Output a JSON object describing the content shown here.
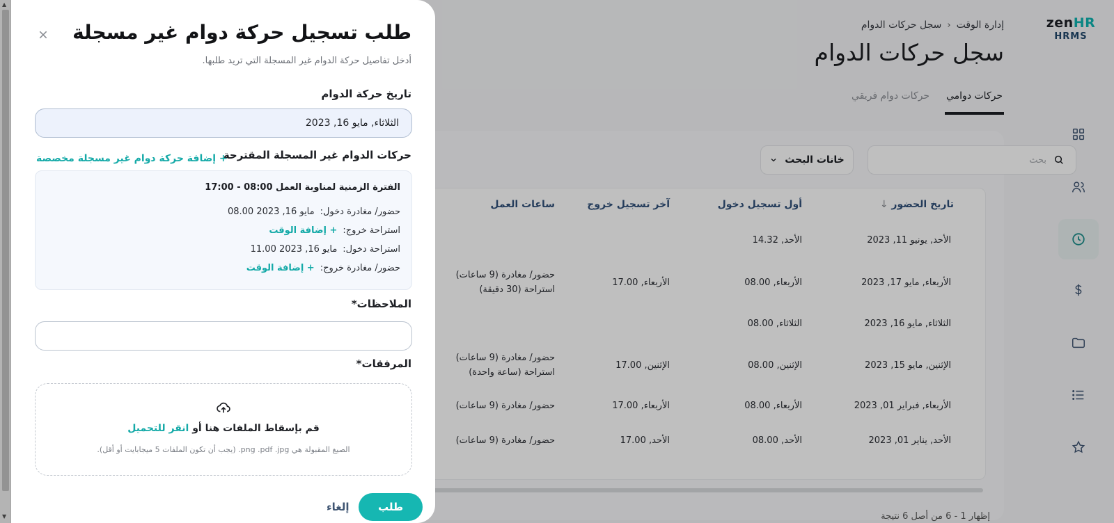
{
  "logo": {
    "zen": "zen",
    "hr": "HR",
    "sub": "HRMS"
  },
  "breadcrumb": {
    "parent": "إدارة الوقت",
    "current": "سجل حركات الدوام"
  },
  "page_title": "سجل حركات الدوام",
  "tabs": [
    {
      "label": "حركات دوامي",
      "active": true
    },
    {
      "label": "حركات دوام فريقي",
      "active": false
    }
  ],
  "search": {
    "placeholder": "بحث",
    "filter_label": "خانات البحث"
  },
  "table": {
    "headers": [
      "تاريخ الحضور",
      "أول تسجيل دخول",
      "آخر تسجيل خروج",
      "ساعات العمل"
    ],
    "rows": [
      {
        "date": "الأحد, يونيو 11, 2023",
        "first_in": "الأحد, 14.32",
        "last_out": "",
        "hours": [
          "",
          ""
        ]
      },
      {
        "date": "الأربعاء, مايو 17, 2023",
        "first_in": "الأربعاء, 08.00",
        "last_out": "الأربعاء, 17.00",
        "hours": [
          "حضور/ مغادرة (9 ساعات)",
          "استراحة (30 دقيقة)"
        ]
      },
      {
        "date": "الثلاثاء, مايو 16, 2023",
        "first_in": "الثلاثاء, 08.00",
        "last_out": "",
        "hours": [
          "",
          ""
        ]
      },
      {
        "date": "الإثنين, مايو 15, 2023",
        "first_in": "الإثنين, 08.00",
        "last_out": "الإثنين, 17.00",
        "hours": [
          "حضور/ مغادرة (9 ساعات)",
          "استراحة (ساعة واحدة)"
        ]
      },
      {
        "date": "الأربعاء, فبراير 01, 2023",
        "first_in": "الأربعاء, 08.00",
        "last_out": "الأربعاء, 17.00",
        "hours": [
          "حضور/ مغادرة (9 ساعات)",
          ""
        ]
      },
      {
        "date": "الأحد, يناير 01, 2023",
        "first_in": "الأحد, 08.00",
        "last_out": "الأحد, 17.00",
        "hours": [
          "حضور/ مغادرة (9 ساعات)",
          ""
        ]
      }
    ]
  },
  "pagination": {
    "text": "إظهار 1 - 6 من أصل 6 نتيجة"
  },
  "modal": {
    "title": "طلب تسجيل حركة دوام غير مسجلة",
    "subtitle": "أدخل تفاصيل حركة الدوام غير المسجلة التي تريد طلبها.",
    "date_label": "تاريخ حركة الدوام",
    "date_value": "الثلاثاء, مايو 16, 2023",
    "suggested_label": "حركات الدوام غير المسجلة المقترحة",
    "add_custom": "+ إضافة حركة دوام غير مسجلة مخصصة",
    "shift_title": "الفترة الزمنية لمناوبة العمل 08:00 - 17:00",
    "entries": [
      {
        "key": "حضور/ مغادرة دخول:",
        "value": "مايو 16, 2023 08.00",
        "add": ""
      },
      {
        "key": "استراحة خروج:",
        "value": "",
        "add": "+ إضافة الوقت"
      },
      {
        "key": "استراحة دخول:",
        "value": "مايو 16, 2023 11.00",
        "add": ""
      },
      {
        "key": "حضور/ مغادرة خروج:",
        "value": "",
        "add": "+ إضافة الوقت"
      }
    ],
    "notes_label": "الملاحظات",
    "attachments_label": "المرفقات",
    "required_mark": "*",
    "drop_text": "قم بإسقاط الملفات هنا أو",
    "drop_link": "انقر للتحميل",
    "drop_hint": "الصيغ المقبولة هي png .pdf .jpg. (يجب أن تكون الملفات 5 ميجابايت أو أقل).",
    "submit": "طلب",
    "cancel": "إلغاء"
  },
  "colors": {
    "accent": "#16b7b2",
    "link": "#15aaa8",
    "header_text": "#31507a"
  }
}
